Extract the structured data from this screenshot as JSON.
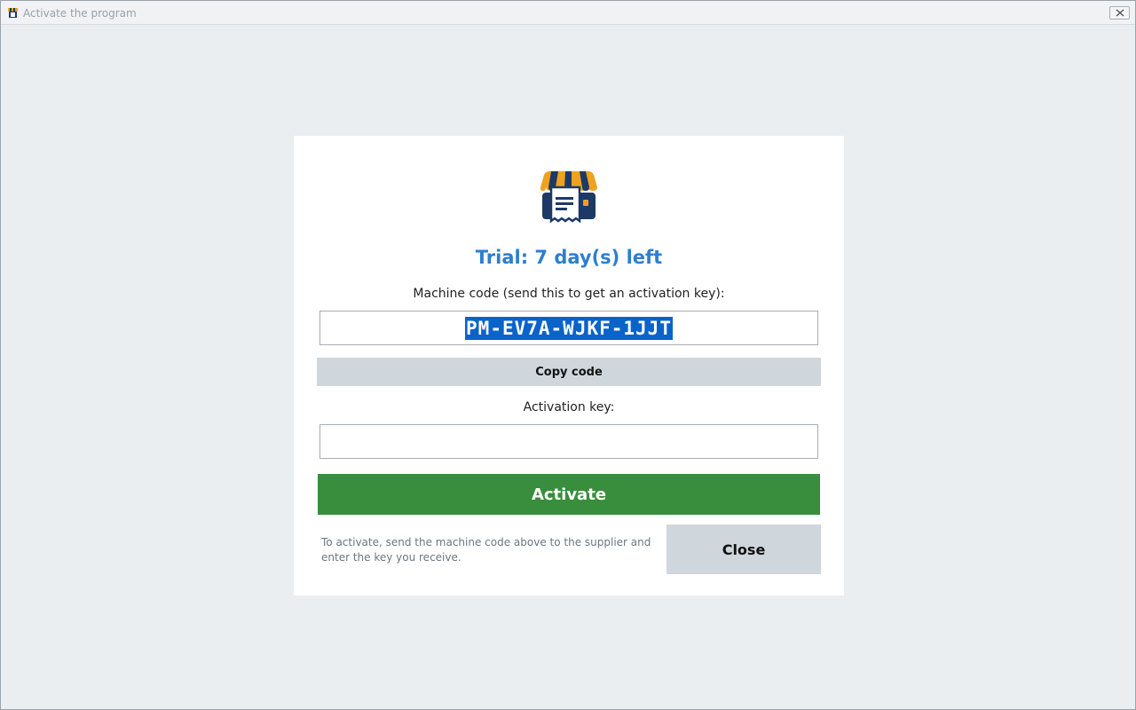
{
  "window": {
    "title": "Activate the program",
    "close_glyph": "✕",
    "icon": "store-icon"
  },
  "card": {
    "logo_icon": "storefront-receipt-icon",
    "trial_text": "Trial: 7 day(s) left",
    "machine_code_label": "Machine code (send this to get an activation key):",
    "machine_code_value": "PM-EV7A-WJKF-1JJT",
    "copy_button": "Copy code",
    "activation_key_label": "Activation key:",
    "activation_key_value": "",
    "activate_button": "Activate",
    "hint_text": "To activate, send the machine code above to the supplier and enter the key you receive.",
    "close_button": "Close"
  },
  "colors": {
    "accent_blue": "#2c7fd1",
    "activate_green": "#388e3c",
    "selection_blue": "#0a63c9",
    "logo_navy": "#1d3a66",
    "logo_amber": "#f0a21f"
  }
}
